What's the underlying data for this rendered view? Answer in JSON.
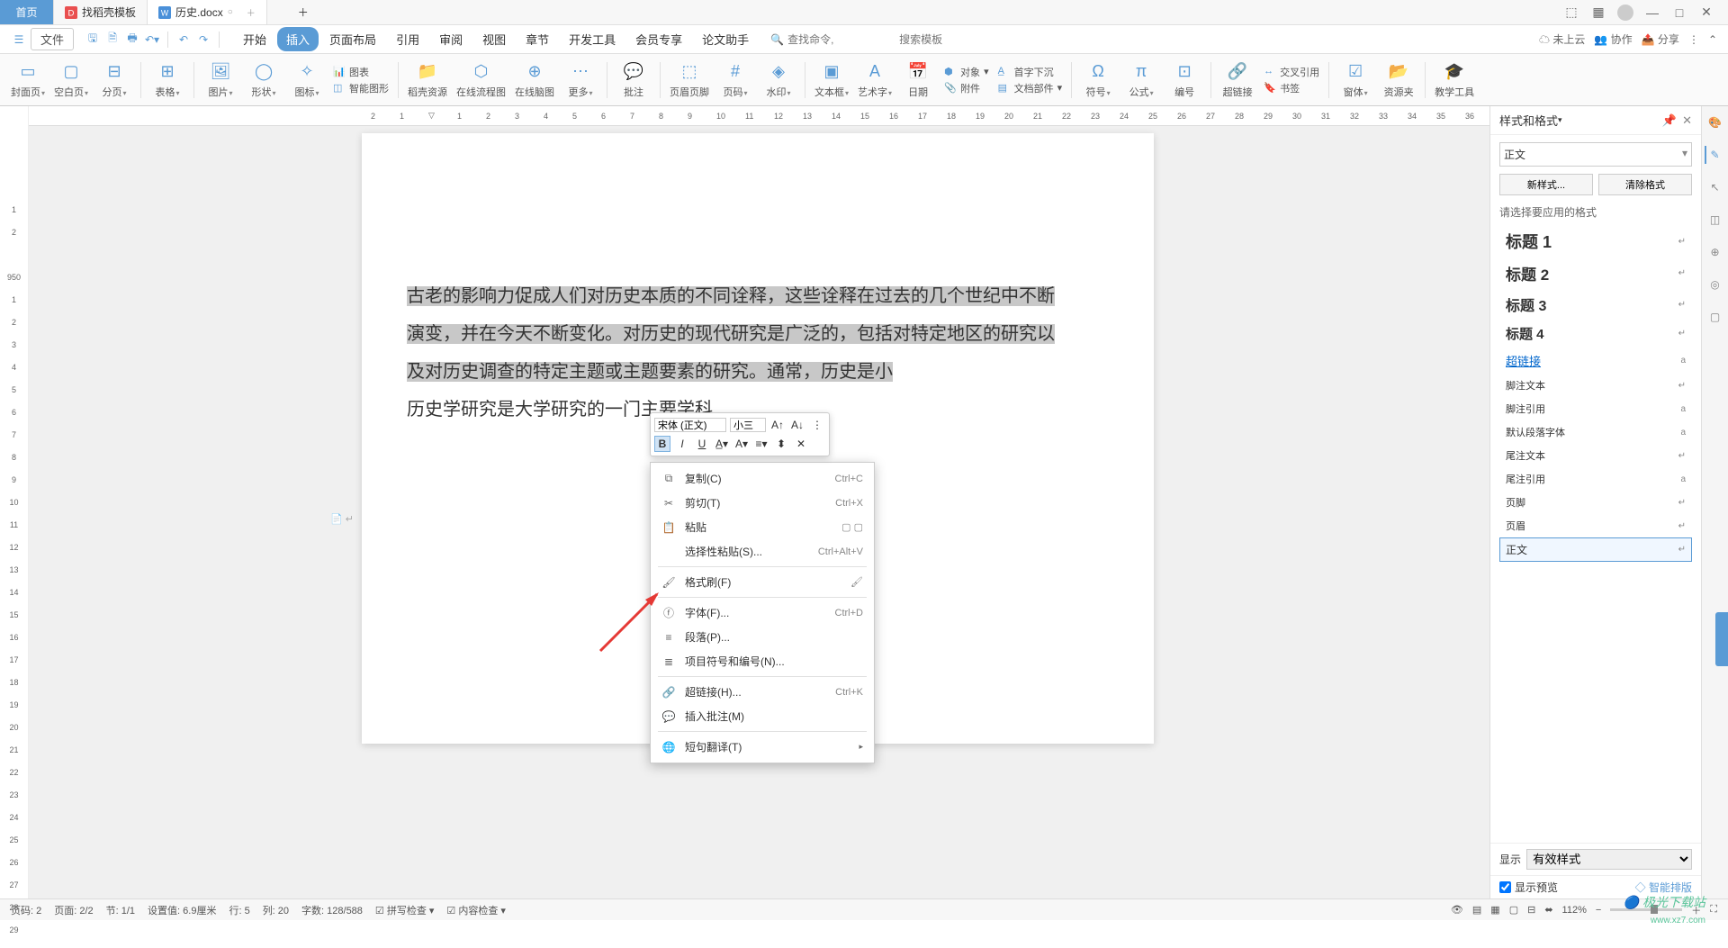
{
  "titlebar": {
    "tab_home": "首页",
    "tab_template": "找稻壳模板",
    "tab_doc": "历史.docx"
  },
  "menu": {
    "file": "文件",
    "tabs": [
      "开始",
      "插入",
      "页面布局",
      "引用",
      "审阅",
      "视图",
      "章节",
      "开发工具",
      "会员专享",
      "论文助手"
    ],
    "active_tab": "插入",
    "search_cmd": "查找命令,",
    "search_tpl": "搜索模板",
    "cloud": "未上云",
    "coop": "协作",
    "share": "分享"
  },
  "ribbon": {
    "cover": "封面页",
    "blank": "空白页",
    "break": "分页",
    "table": "表格",
    "pic": "图片",
    "shape": "形状",
    "icon": "图标",
    "smart": "智能图形",
    "chart_label": "图表",
    "resource": "稻壳资源",
    "flow": "在线流程图",
    "mind": "在线脑图",
    "more": "更多",
    "comment": "批注",
    "header": "页眉页脚",
    "pagenum": "页码",
    "watermark": "水印",
    "textbox": "文本框",
    "art": "艺术字",
    "date": "日期",
    "obj": "对象",
    "attach": "附件",
    "dropcap": "首字下沉",
    "docpart": "文档部件",
    "symbol": "符号",
    "formula": "公式",
    "number": "编号",
    "link": "超链接",
    "xref": "交叉引用",
    "bookmark": "书签",
    "form": "窗体",
    "resfolder": "资源夹",
    "teach": "教学工具"
  },
  "doc": {
    "sel_text": "古老的影响力促成人们对历史本质的不同诠释，这些诠释在过去的几个世纪中不断演变，并在今天不断变化。对历史的现代研究是广泛的，包括对特定地区的研究以及对历史调查的特定主题或主题要素的研究。通常，历史是小",
    "after_text": "历史学研究是大学研究的一门主要学科"
  },
  "mini": {
    "font": "宋体 (正文)",
    "size": "小三"
  },
  "context": {
    "copy": "复制(C)",
    "copy_sc": "Ctrl+C",
    "cut": "剪切(T)",
    "cut_sc": "Ctrl+X",
    "paste": "粘贴",
    "paste_special": "选择性粘贴(S)...",
    "paste_sc": "Ctrl+Alt+V",
    "format": "格式刷(F)",
    "font": "字体(F)...",
    "font_sc": "Ctrl+D",
    "para": "段落(P)...",
    "bullets": "项目符号和编号(N)...",
    "hyperlink": "超链接(H)...",
    "hyperlink_sc": "Ctrl+K",
    "ins_comment": "插入批注(M)",
    "translate": "短句翻译(T)"
  },
  "panel": {
    "title": "样式和格式",
    "current": "正文",
    "new_style": "新样式...",
    "clear": "清除格式",
    "choose": "请选择要应用的格式",
    "styles": {
      "h1": "标题 1",
      "h2": "标题 2",
      "h3": "标题 3",
      "h4": "标题 4",
      "link": "超链接",
      "footnote_text": "脚注文本",
      "footnote_ref": "脚注引用",
      "default_font": "默认段落字体",
      "endnote_text": "尾注文本",
      "endnote_ref": "尾注引用",
      "footer": "页脚",
      "header": "页眉",
      "body": "正文"
    },
    "show": "显示",
    "show_opt": "有效样式",
    "preview": "显示预览",
    "smart_layout": "智能排版"
  },
  "status": {
    "page_idx": "页码: 2",
    "page": "页面: 2/2",
    "section": "节: 1/1",
    "pos": "设置值: 6.9厘米",
    "line": "行: 5",
    "col": "列: 20",
    "words": "字数: 128/588",
    "spell": "拼写检查",
    "content": "内容检查",
    "zoom": "112%"
  }
}
